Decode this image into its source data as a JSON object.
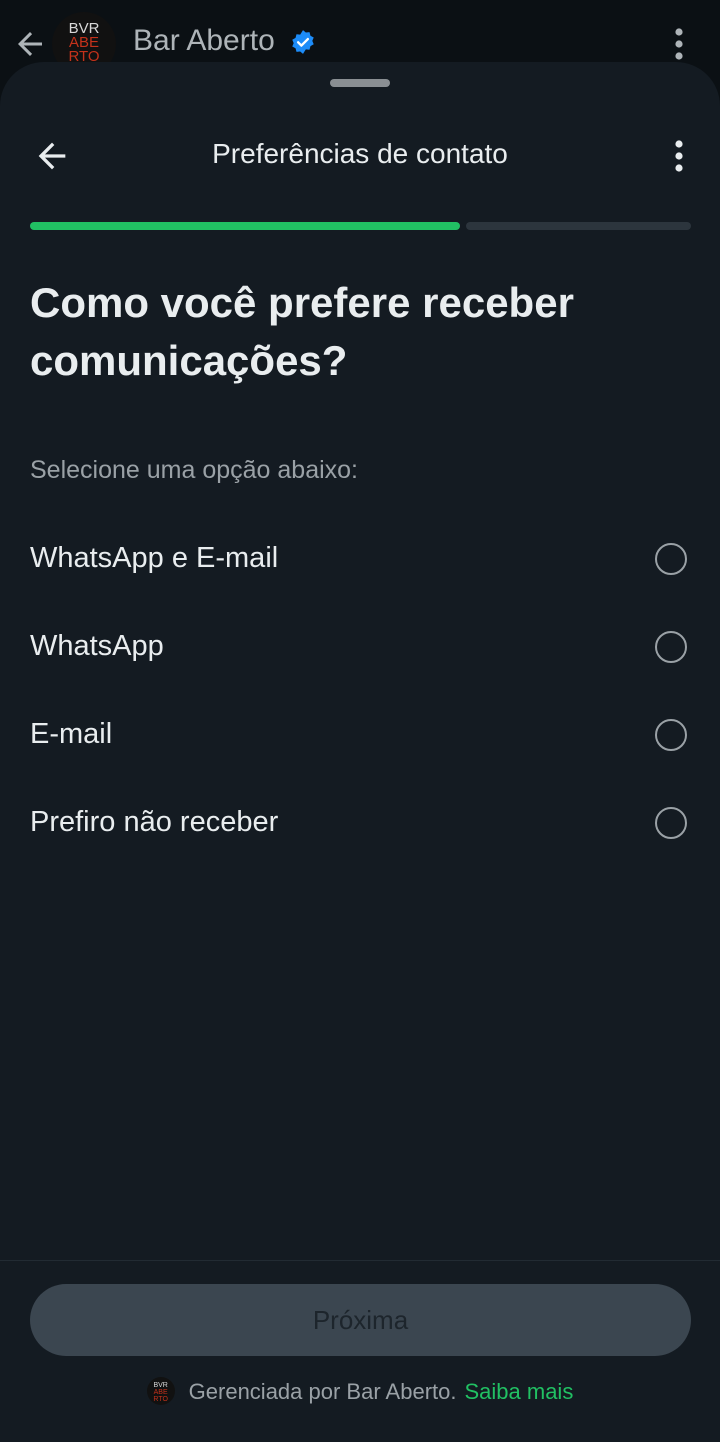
{
  "header": {
    "back_icon": "arrow-left-icon",
    "avatar": {
      "line1": "BVR",
      "line2": "ABE",
      "line3": "RTO"
    },
    "title": "Bar Aberto",
    "verified_icon": "verified-badge-icon",
    "menu_icon": "more-vertical-icon"
  },
  "sheet": {
    "back_icon": "arrow-left-icon",
    "title": "Preferências de contato",
    "menu_icon": "more-vertical-icon",
    "progress": {
      "value": 0.65
    },
    "question": "Como você prefere receber comunicações?",
    "instruction": "Selecione uma opção abaixo:",
    "options": [
      {
        "label": "WhatsApp e E-mail",
        "selected": false
      },
      {
        "label": "WhatsApp",
        "selected": false
      },
      {
        "label": "E-mail",
        "selected": false
      },
      {
        "label": "Prefiro não receber",
        "selected": false
      }
    ],
    "next_button": "Próxima",
    "managed_by": "Gerenciada por Bar Aberto.",
    "learn_more": "Saiba mais"
  },
  "colors": {
    "accent": "#21c063",
    "background": "#141b22",
    "button_disabled": "#3b4650",
    "verified": "#1d8cf8"
  }
}
